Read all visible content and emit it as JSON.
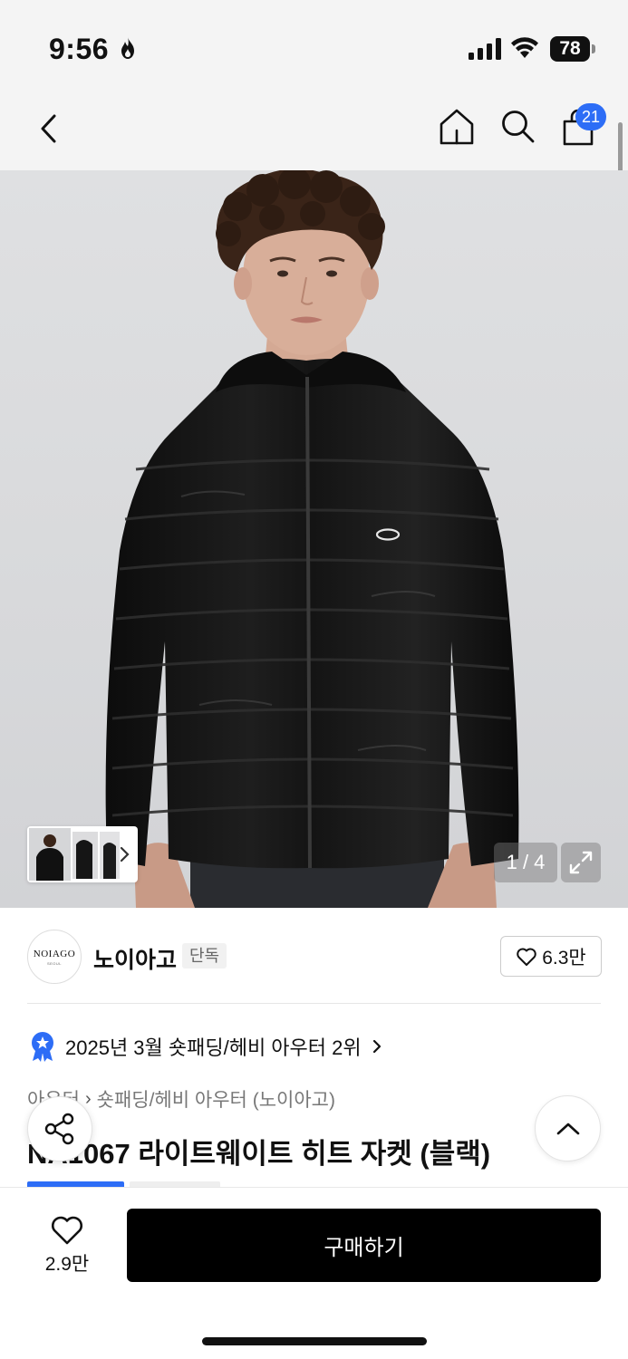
{
  "status_bar": {
    "time": "9:56",
    "battery": "78"
  },
  "nav": {
    "back_icon": "chevron-left-icon",
    "home_icon": "home-icon",
    "search_icon": "search-icon",
    "cart_icon": "shopping-bag-icon",
    "cart_count": "21"
  },
  "gallery": {
    "counter": "1 / 4",
    "expand_icon": "expand-icon",
    "thumbs_icon": "chevron-right-icon"
  },
  "brand": {
    "logo_text": "NOIAGO",
    "logo_subtext": "SEOUL",
    "name": "노이아고",
    "badge": "단독",
    "like_count": "6.3만"
  },
  "ranking": {
    "text": "2025년 3월 숏패딩/헤비 아우터 2위",
    "accent_color": "#2d6df6"
  },
  "breadcrumb": {
    "items": [
      "아우터",
      "숏패딩/헤비 아우터 (노이아고)"
    ]
  },
  "product": {
    "title": "NA1067 라이트웨이트 히트 자켓 (블랙)"
  },
  "actions": {
    "wish_count": "2.9만",
    "buy_label": "구매하기"
  },
  "colors": {
    "accent": "#2d6df6",
    "primary_button": "#000000"
  }
}
